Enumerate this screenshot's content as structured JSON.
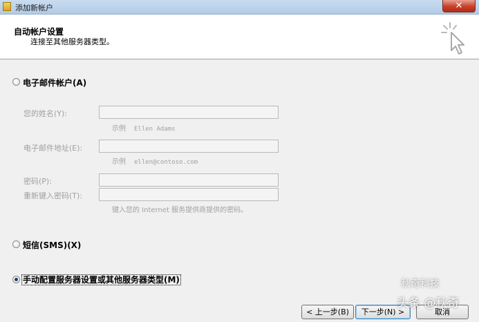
{
  "window": {
    "title": "添加新帐户",
    "close_glyph": "✕"
  },
  "header": {
    "title": "自动帐户设置",
    "subtitle": "连接至其他服务器类型。"
  },
  "options": {
    "email_account": {
      "label": "电子邮件帐户(A)",
      "selected": false
    },
    "sms": {
      "label": "短信(SMS)(X)",
      "selected": false
    },
    "manual": {
      "label": "手动配置服务器设置或其他服务器类型(M)",
      "selected": true
    }
  },
  "form": {
    "name_label": "您的姓名(Y):",
    "name_value": "",
    "name_example_prefix": "示例",
    "name_example_value": "Ellen Adams",
    "email_label": "电子邮件地址(E):",
    "email_value": "",
    "email_example_prefix": "示例",
    "email_example_value": "ellen@contoso.com",
    "password_label": "密码(P):",
    "password_value": "",
    "retype_label": "重新键入密码(T):",
    "retype_value": "",
    "password_hint": "键入您的 Internet 服务提供商提供的密码。"
  },
  "buttons": {
    "back": "< 上一步(B)",
    "next": "下一步(N) >",
    "cancel": "取消"
  },
  "watermark": {
    "main": "头条 @秋奇",
    "sub": "秋奇科技"
  },
  "colors": {
    "selected_radio": "#1f3f6e",
    "disabled_text": "#a0a0a0",
    "titlebar": "#c9dcf0"
  },
  "icons": {
    "app": "envelope-icon",
    "wizard": "cursor-sparkle-icon"
  }
}
